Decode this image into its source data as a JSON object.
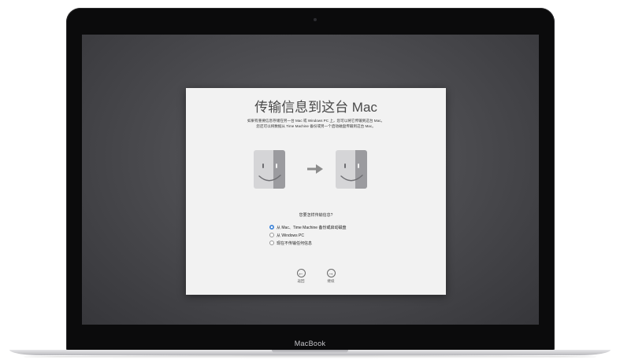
{
  "device": {
    "brand_label": "MacBook"
  },
  "dialog": {
    "title": "传输信息到这台 Mac",
    "description_line1": "如果有重要信息存储在另一台 Mac 或 Windows PC 上，您可以将它传输到这台 Mac。",
    "description_line2": "您还可以将数据从 Time Machine 备份或另一个启动磁盘传输到这台 Mac。",
    "question": "您要怎样传输信息?",
    "options": [
      {
        "label": "从 Mac、Time Machine 备份或启动磁盘",
        "selected": true
      },
      {
        "label": "从 Windows PC",
        "selected": false
      },
      {
        "label": "现在不传输任何信息",
        "selected": false
      }
    ],
    "back_label": "返回",
    "continue_label": "继续"
  },
  "icons": {
    "source": "finder-icon",
    "arrow": "right-arrow-icon",
    "target": "finder-icon",
    "back": "left-arrow-circle-icon",
    "continue": "right-arrow-circle-icon"
  },
  "colors": {
    "accent": "#3b82d8",
    "screen_bg": "#4c4c50",
    "dialog_bg": "#f2f2f2"
  }
}
